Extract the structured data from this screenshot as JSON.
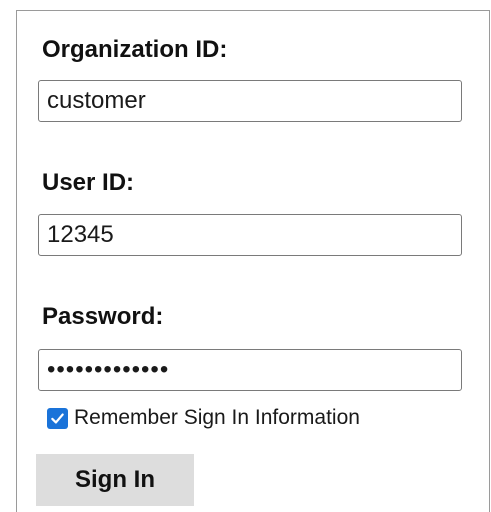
{
  "form": {
    "organization_label": "Organization ID:",
    "organization_value": "customer",
    "user_label": "User ID:",
    "user_value": "12345",
    "password_label": "Password:",
    "password_masked": "•••••••••••••",
    "remember_label": "Remember Sign In Information",
    "remember_checked": true,
    "signin_label": "Sign In"
  },
  "colors": {
    "checkbox_accent": "#1a73d9",
    "button_background": "#dddddd"
  }
}
